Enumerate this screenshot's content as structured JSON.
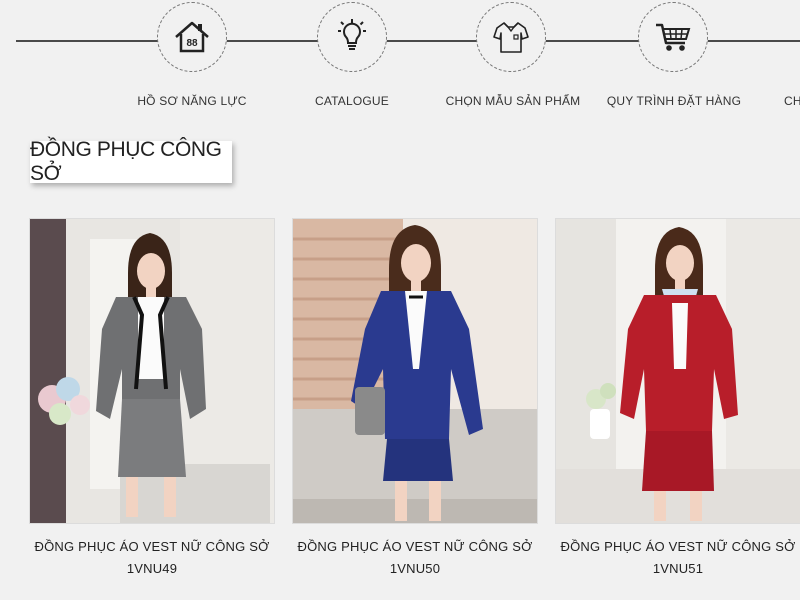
{
  "nav": {
    "items": [
      {
        "label": "HỒ SƠ NĂNG LỰC",
        "icon": "house-icon"
      },
      {
        "label": "CATALOGUE",
        "icon": "lightbulb-icon"
      },
      {
        "label": "CHỌN MẪU SẢN PHẨM",
        "icon": "shirt-icon"
      },
      {
        "label": "QUY TRÌNH ĐẶT HÀNG",
        "icon": "cart-icon"
      },
      {
        "label": "CH",
        "icon": ""
      }
    ]
  },
  "section": {
    "title": "ĐỒNG PHỤC CÔNG SỞ"
  },
  "products": [
    {
      "name": "ĐỒNG PHỤC ÁO VEST NỮ CÔNG SỞ",
      "code": "1VNU49",
      "suit_color": "#6f7072"
    },
    {
      "name": "ĐỒNG PHỤC ÁO VEST NỮ CÔNG SỞ",
      "code": "1VNU50",
      "suit_color": "#2a3a8f"
    },
    {
      "name": "ĐỒNG PHỤC ÁO VEST NỮ CÔNG SỞ",
      "code": "1VNU51",
      "suit_color": "#b81e2a"
    }
  ]
}
